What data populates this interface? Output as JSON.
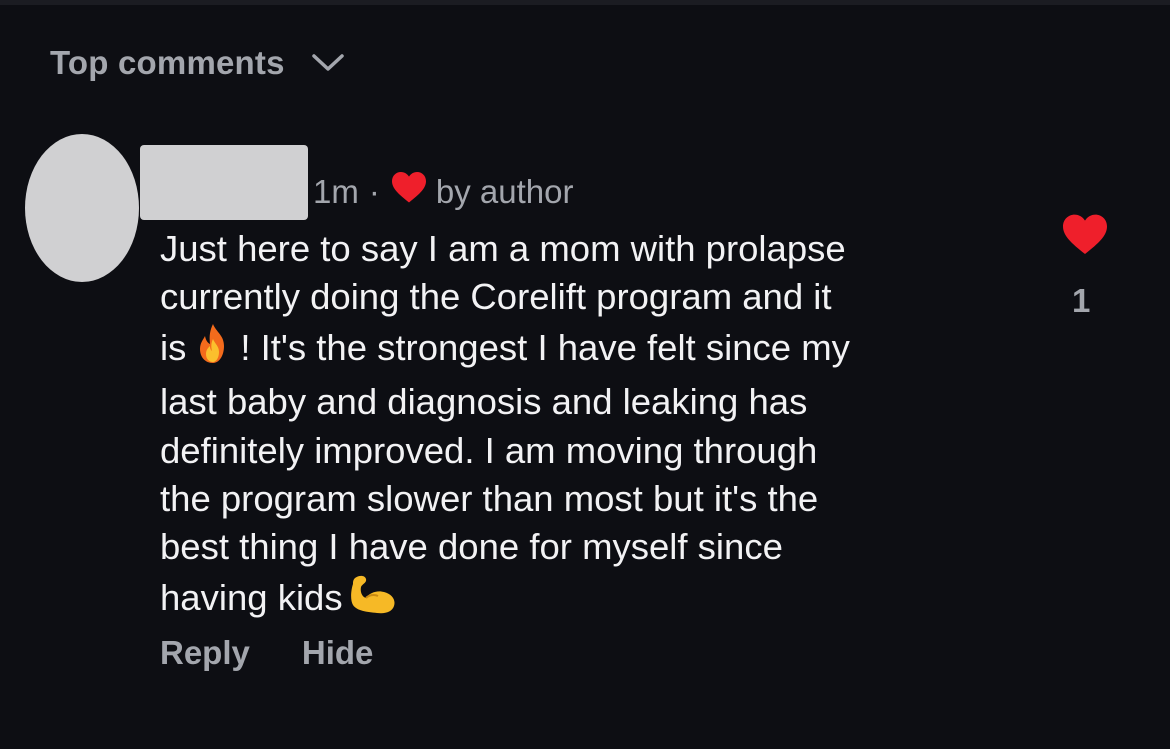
{
  "header": {
    "sort_label": "Top comments",
    "sort_icon": "chevron-down-icon"
  },
  "comment": {
    "author_name": "",
    "time": "1m",
    "separator": "·",
    "author_like_icon": "heart-icon",
    "author_like_text": "by author",
    "body_parts": [
      "Just here to say I am a mom with prolapse\ncurrently doing the Corelift program and it\nis",
      "! It's the strongest I have felt since my\nlast baby and diagnosis and leaking has\ndefinitely improved. I am moving through\nthe program slower than most but it's the\nbest thing I have done for myself since\nhaving kids"
    ],
    "emojis": [
      "fire-emoji",
      "flexed-biceps-emoji"
    ],
    "like_count": "1",
    "like_icon": "heart-icon",
    "colors": {
      "heart": "#ef1f2b",
      "text": "#f2f2f4",
      "muted": "#a3a6ad",
      "background": "#0d0e13",
      "redaction": "#d0d0d2"
    }
  },
  "actions": {
    "reply_label": "Reply",
    "hide_label": "Hide"
  }
}
